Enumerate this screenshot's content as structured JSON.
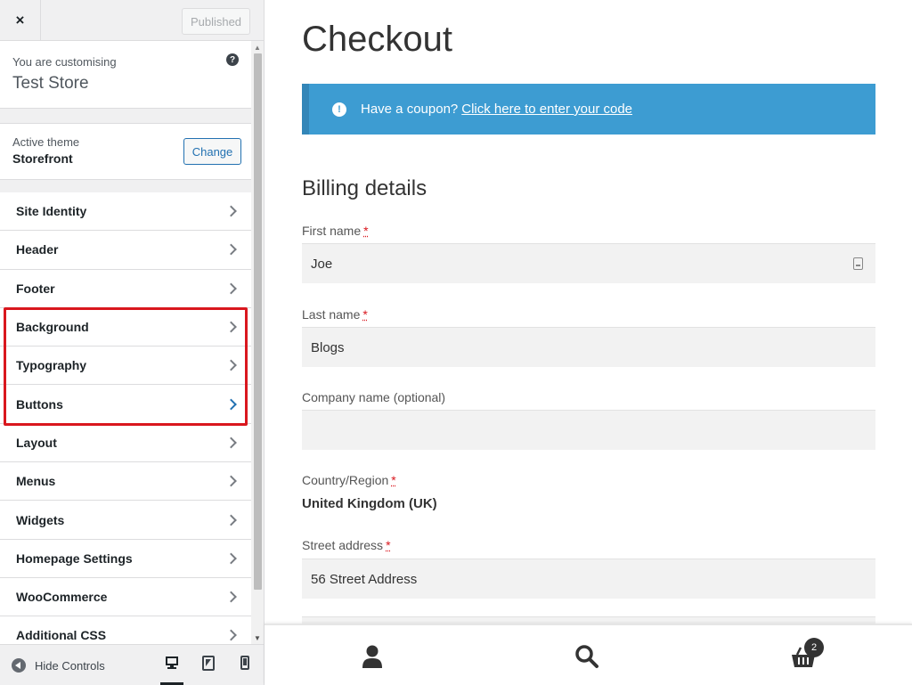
{
  "sidebar": {
    "close_label": "×",
    "published_label": "Published",
    "customising_label": "You are customising",
    "site_name": "Test Store",
    "active_theme_label": "Active theme",
    "theme_name": "Storefront",
    "change_label": "Change",
    "items": [
      {
        "label": "Site Identity"
      },
      {
        "label": "Header"
      },
      {
        "label": "Footer"
      },
      {
        "label": "Background"
      },
      {
        "label": "Typography"
      },
      {
        "label": "Buttons"
      },
      {
        "label": "Layout"
      },
      {
        "label": "Menus"
      },
      {
        "label": "Widgets"
      },
      {
        "label": "Homepage Settings"
      },
      {
        "label": "WooCommerce"
      },
      {
        "label": "Additional CSS"
      }
    ],
    "highlight_color": "#d9171e",
    "hide_controls_label": "Hide Controls",
    "help_label": "?"
  },
  "preview": {
    "page_title": "Checkout",
    "coupon_text": "Have a coupon?",
    "coupon_link": "Click here to enter your code",
    "coupon_color": "#3d9cd2",
    "billing_title": "Billing details",
    "required_marker": "*",
    "fields": {
      "first_name_label": "First name",
      "first_name_value": "Joe",
      "last_name_label": "Last name",
      "last_name_value": "Blogs",
      "company_label": "Company name (optional)",
      "company_value": "",
      "country_label": "Country/Region",
      "country_value": "United Kingdom (UK)",
      "street_label": "Street address",
      "street_value": "56 Street Address"
    },
    "cart_count": "2"
  }
}
